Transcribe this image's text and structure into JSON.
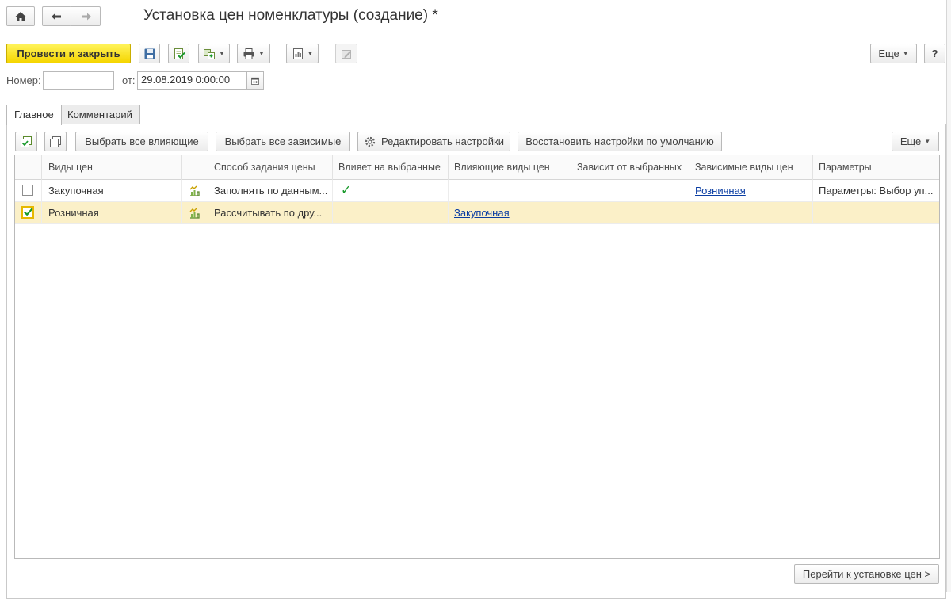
{
  "window": {
    "title": "Установка цен номенклатуры (создание) *"
  },
  "toolbar": {
    "post_and_close": "Провести и закрыть",
    "more": "Еще",
    "help": "?"
  },
  "header": {
    "number_label": "Номер:",
    "number_value": "",
    "date_label": "от:",
    "date_value": "29.08.2019  0:00:00"
  },
  "tabs": [
    {
      "label": "Главное",
      "active": true
    },
    {
      "label": "Комментарий",
      "active": false
    }
  ],
  "grid_toolbar": {
    "select_influencing": "Выбрать все влияющие",
    "select_dependent": "Выбрать все зависимые",
    "edit_settings": "Редактировать настройки",
    "restore_defaults": "Восстановить настройки по умолчанию",
    "more": "Еще"
  },
  "grid": {
    "columns": [
      "Виды цен",
      "Способ задания цены",
      "Влияет на выбранные",
      "Влияющие виды цен",
      "Зависит от выбранных",
      "Зависимые виды цен",
      "Параметры"
    ],
    "rows": [
      {
        "checked": false,
        "price_type": "Закупочная",
        "method": "Заполнять по данным...",
        "affects_selected": "✓",
        "influencing_types": "",
        "depends_on_selected": "",
        "dependent_types": "Розничная",
        "parameters": "Параметры: Выбор уп..."
      },
      {
        "checked": true,
        "price_type": "Розничная",
        "method": "Рассчитывать по дру...",
        "affects_selected": "",
        "influencing_types": "Закупочная",
        "depends_on_selected": "",
        "dependent_types": "",
        "parameters": ""
      }
    ]
  },
  "footer": {
    "go_to_pricing": "Перейти к установке цен >"
  },
  "colors": {
    "primary_button": "#f5d500",
    "selected_row": "#fbf0c8",
    "link": "#0b3ea3",
    "check_green": "#1a9a2c"
  }
}
